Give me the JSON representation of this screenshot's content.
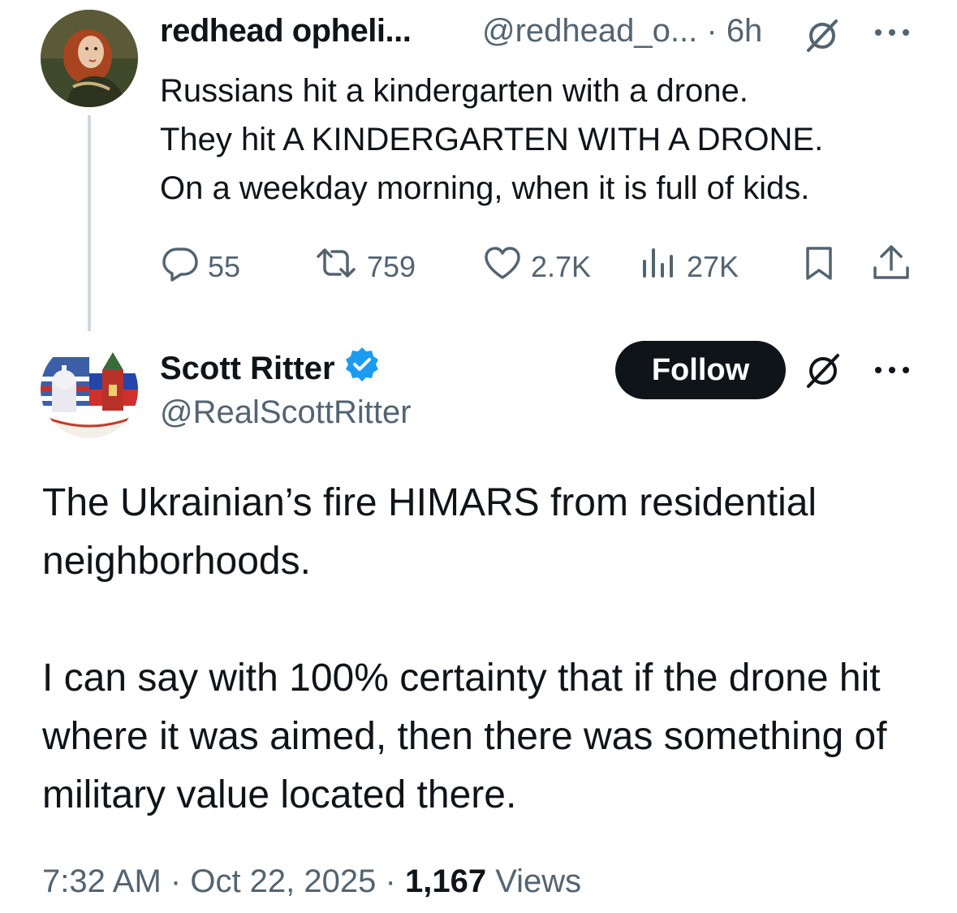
{
  "reply_tweet": {
    "display_name": "redhead opheli...",
    "handle": "@redhead_o...",
    "separator": "·",
    "time": "6h",
    "text": "Russians hit a kindergarten with a drone.\nThey hit A KINDERGARTEN WITH A DRONE.\nOn a weekday morning, when it is full of kids.",
    "actions": {
      "replies": "55",
      "reposts": "759",
      "likes": "2.7K",
      "views": "27K"
    },
    "icons": [
      "grok-slash-icon",
      "more-icon",
      "reply-icon",
      "repost-icon",
      "like-icon",
      "views-icon",
      "bookmark-icon",
      "share-icon"
    ]
  },
  "main_tweet": {
    "display_name": "Scott Ritter",
    "handle": "@RealScottRitter",
    "follow_label": "Follow",
    "verified_color": "#1d9bf0",
    "text": "The Ukrainian’s fire HIMARS from residential neighborhoods.\n\nI can say with 100% certainty that if the drone hit where it was aimed, then there was something of military value located there.",
    "footer": {
      "time": "7:32 AM",
      "sep1": "·",
      "date": "Oct 22, 2025",
      "sep2": "·",
      "views_count": "1,167",
      "views_label": "Views"
    }
  },
  "colors": {
    "text_primary": "#0f1419",
    "text_secondary": "#536471",
    "thread_line": "#cfd9de",
    "button_bg": "#0f1419",
    "button_text": "#ffffff"
  }
}
